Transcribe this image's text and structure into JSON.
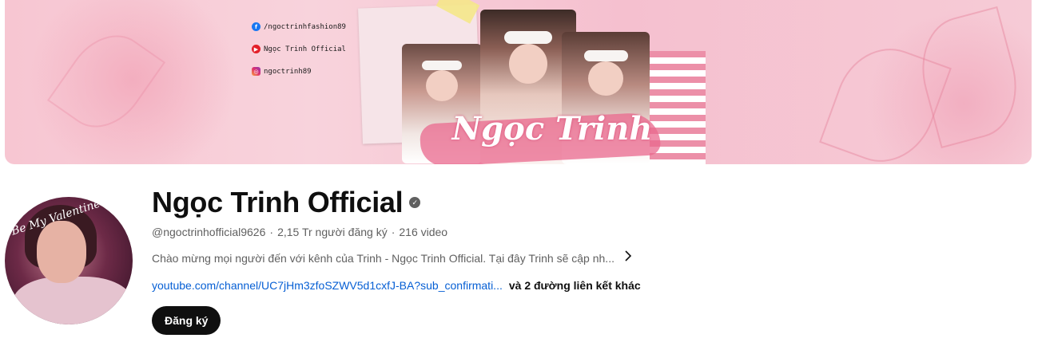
{
  "banner": {
    "social_links": [
      {
        "icon": "facebook-icon",
        "text": "/ngoctrinhfashion89",
        "color": "#1877f2"
      },
      {
        "icon": "youtube-icon",
        "text": "Ngọc Trinh Official",
        "color": "#e3202a"
      },
      {
        "icon": "instagram-icon",
        "text": "ngoctrinh89",
        "color": "#e1306c"
      }
    ],
    "art_text": "Ngọc Trinh"
  },
  "avatar": {
    "script_text": "Be My Valentine"
  },
  "channel": {
    "name": "Ngọc Trinh Official",
    "handle": "@ngoctrinhofficial9626",
    "subscribers": "2,15 Tr người đăng ký",
    "videos": "216 video",
    "separator": "·",
    "description": "Chào mừng mọi người đến với kênh của Trinh - Ngọc Trinh Official. Tại đây Trinh sẽ cập nh...",
    "link_url": "youtube.com/channel/UC7jHm3zfoSZWV5d1cxfJ-BA?sub_confirmati...",
    "more_links": "và 2 đường liên kết khác",
    "subscribe_label": "Đăng ký"
  }
}
